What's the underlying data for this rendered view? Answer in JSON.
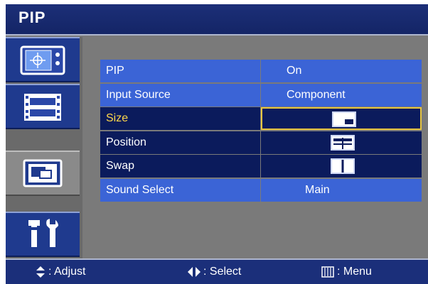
{
  "window": {
    "title": "PIP"
  },
  "sidebar": {
    "items": [
      {
        "icon": "picture-settings-icon",
        "active": false
      },
      {
        "icon": "film-icon",
        "active": false
      },
      {
        "icon": "pip-tv-icon",
        "active": true
      },
      {
        "icon": "tools-icon",
        "active": false
      }
    ]
  },
  "menu": {
    "rows": [
      {
        "label": "PIP",
        "value": "On"
      },
      {
        "label": "Input Source",
        "value": "Component"
      },
      {
        "label": "Size",
        "value_icon": "pip-size-small-icon",
        "selected": true
      },
      {
        "label": "Position",
        "value_icon": "pip-position-icon"
      },
      {
        "label": "Swap",
        "value_icon": "pip-swap-icon"
      },
      {
        "label": "Sound Select",
        "value": "Main"
      }
    ]
  },
  "footer": {
    "adjust": ": Adjust",
    "select": ": Select",
    "menu": ": Menu"
  },
  "colors": {
    "title_bar": "#1c2f78",
    "row_blue": "#3b64d6",
    "row_dark": "#0b1b5c",
    "highlight_text": "#ffd84a",
    "highlight_border": "#e8c640",
    "background": "#7a7a7a"
  }
}
